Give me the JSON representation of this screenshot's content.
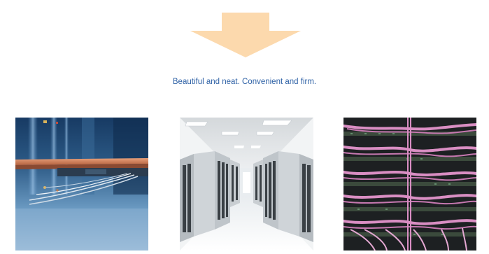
{
  "arrow": {
    "icon": "down-arrow-icon",
    "color": "#fcd9ad"
  },
  "tagline": {
    "text": "Beautiful and neat. Convenient and firm.",
    "color": "#2f62a6"
  },
  "gallery": [
    {
      "icon": "desk-edge-cable-photo"
    },
    {
      "icon": "server-room-aisle-photo"
    },
    {
      "icon": "rack-cable-bundles-photo"
    }
  ]
}
